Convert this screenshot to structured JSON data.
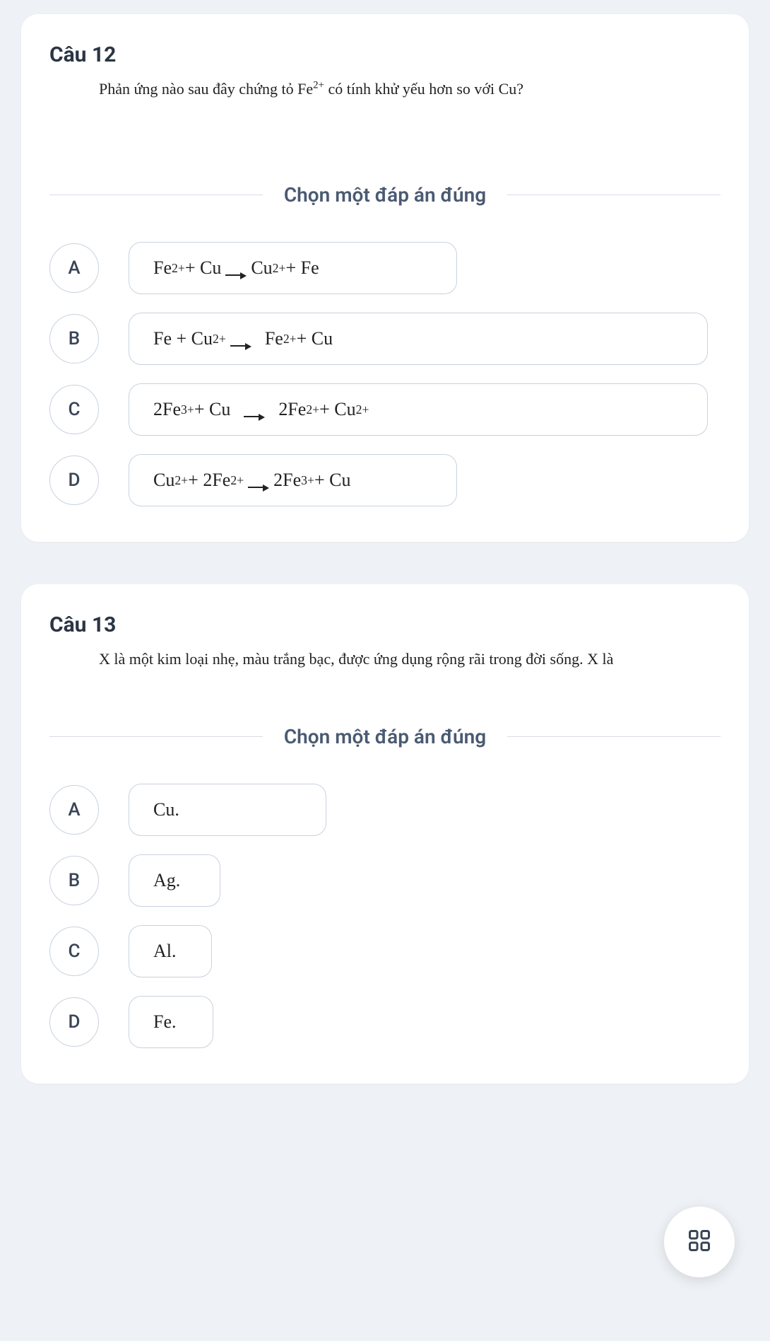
{
  "questions": [
    {
      "title": "Câu 12",
      "prompt_html": "Phản ứng nào sau đây chứng tỏ Fe<sup>2+</sup> có tính khử yếu hơn so với Cu?",
      "instruction": "Chọn một đáp án đúng",
      "options": [
        {
          "letter": "A",
          "width": "med",
          "html": "Fe<sup>2+</sup> + Cu <span class=\"arrow\"></span> Cu<sup>2+</sup> + Fe"
        },
        {
          "letter": "B",
          "width": "wide",
          "html": "Fe + Cu<sup>2+</sup> <span class=\"arrow\"></span>&nbsp; Fe<sup>2+</sup> + Cu"
        },
        {
          "letter": "C",
          "width": "wide",
          "html": "2Fe<sup>3+</sup> + Cu &nbsp;<span class=\"arrow\"></span>&nbsp; 2Fe<sup>2+</sup> + Cu<sup>2+</sup>"
        },
        {
          "letter": "D",
          "width": "med",
          "html": "Cu<sup>2+</sup> + 2Fe<sup>2+</sup> <span class=\"arrow\"></span> 2Fe<sup>3+</sup> + Cu"
        }
      ]
    },
    {
      "title": "Câu 13",
      "prompt_html": "X là một kim loại nhẹ, màu trắng bạc, được ứng dụng rộng rãi trong đời sống. X là",
      "instruction": "Chọn một đáp án đúng",
      "options": [
        {
          "letter": "A",
          "width": "w1",
          "html": "Cu."
        },
        {
          "letter": "B",
          "width": "w2",
          "html": "Ag."
        },
        {
          "letter": "C",
          "width": "w3",
          "html": "Al."
        },
        {
          "letter": "D",
          "width": "w4",
          "html": "Fe."
        }
      ]
    }
  ],
  "fab_name": "grid-icon"
}
